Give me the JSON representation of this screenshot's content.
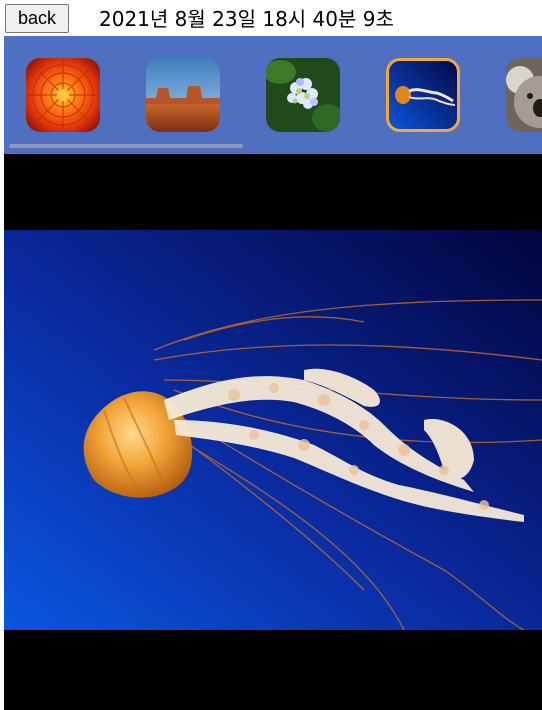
{
  "header": {
    "back_label": "back",
    "datetime": "2021년 8월 23일 18시 40분 9초"
  },
  "gallery": {
    "thumbnails": [
      {
        "name": "thumb-chrysanthemum",
        "description_icon": "orange-flower-photo",
        "selected": false
      },
      {
        "name": "thumb-desert",
        "description_icon": "desert-mesa-photo",
        "selected": false
      },
      {
        "name": "thumb-hydrangeas",
        "description_icon": "hydrangea-photo",
        "selected": false
      },
      {
        "name": "thumb-jellyfish",
        "description_icon": "jellyfish-photo",
        "selected": true
      },
      {
        "name": "thumb-koala",
        "description_icon": "koala-photo",
        "selected": false
      }
    ],
    "strip_color": "#4f70c1",
    "selected_border_color": "#f0a93a"
  },
  "viewer": {
    "current_image": "jellyfish-photo",
    "background_color": "#000000"
  }
}
